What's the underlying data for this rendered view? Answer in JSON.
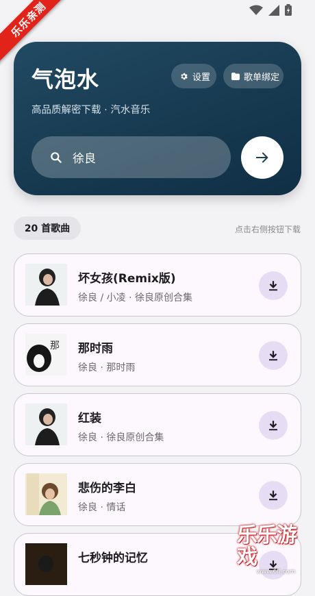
{
  "status_bar": {
    "icons": [
      "wifi-icon",
      "signal-icon",
      "battery-icon"
    ]
  },
  "corner_ribbon": {
    "text": "乐乐亲测"
  },
  "header": {
    "title": "气泡水",
    "subtitle": "高品质解密下载 · 汽水音乐",
    "settings_label": "设置",
    "playlist_label": "歌单绑定",
    "search_value": "徐良"
  },
  "results": {
    "count_label": "20 首歌曲",
    "hint": "点击右侧按钮下载"
  },
  "songs": [
    {
      "title": "坏女孩(Remix版)",
      "meta": "徐良 / 小凌 · 徐良原创合集"
    },
    {
      "title": "那时雨",
      "meta": "徐良 · 那时雨"
    },
    {
      "title": "红装",
      "meta": "徐良 · 徐良原创合集"
    },
    {
      "title": "悲伤的李白",
      "meta": "徐良 · 情话"
    },
    {
      "title": "七秒钟的记忆",
      "meta": ""
    }
  ],
  "watermark": {
    "text": "乐乐游戏",
    "url": "www.6ll.com"
  },
  "colors": {
    "hero": "#173a50",
    "accent_download": "#e6ddf4",
    "ribbon": "#e2231a"
  }
}
